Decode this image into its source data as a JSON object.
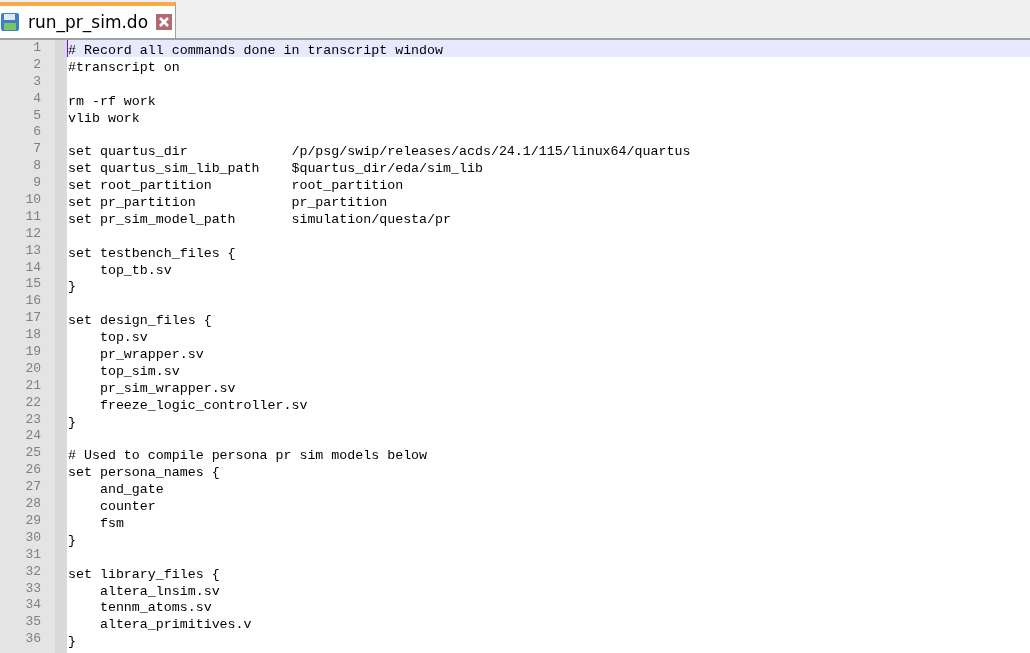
{
  "tabs": [
    {
      "label": "run_pr_sim.do",
      "selected": true
    }
  ],
  "lines": [
    {
      "number": "1",
      "text": "# Record all commands done in transcript window",
      "current": true
    },
    {
      "number": "2",
      "text": "#transcript on",
      "current": false
    },
    {
      "number": "3",
      "current": false
    },
    {
      "number": "4",
      "text": "rm -rf work",
      "current": false
    },
    {
      "number": "5",
      "text": "vlib work",
      "current": false
    },
    {
      "number": "6",
      "current": false
    },
    {
      "number": "7",
      "text": "set quartus_dir             /p/psg/swip/releases/acds/24.1/115/linux64/quartus",
      "current": false
    },
    {
      "number": "8",
      "text": "set quartus_sim_lib_path    $quartus_dir/eda/sim_lib",
      "current": false
    },
    {
      "number": "9",
      "text": "set root_partition          root_partition",
      "current": false
    },
    {
      "number": "10",
      "text": "set pr_partition            pr_partition",
      "current": false
    },
    {
      "number": "11",
      "text": "set pr_sim_model_path       simulation/questa/pr",
      "current": false
    },
    {
      "number": "12",
      "current": false
    },
    {
      "number": "13",
      "text": "set testbench_files {",
      "current": false
    },
    {
      "number": "14",
      "text": "    top_tb.sv",
      "current": false
    },
    {
      "number": "15",
      "text": "}",
      "current": false
    },
    {
      "number": "16",
      "current": false
    },
    {
      "number": "17",
      "text": "set design_files {",
      "current": false
    },
    {
      "number": "18",
      "text": "    top.sv",
      "current": false
    },
    {
      "number": "19",
      "text": "    pr_wrapper.sv",
      "current": false
    },
    {
      "number": "20",
      "text": "    top_sim.sv",
      "current": false
    },
    {
      "number": "21",
      "text": "    pr_sim_wrapper.sv",
      "current": false
    },
    {
      "number": "22",
      "text": "    freeze_logic_controller.sv",
      "current": false
    },
    {
      "number": "23",
      "text": "}",
      "current": false
    },
    {
      "number": "24",
      "current": false
    },
    {
      "number": "25",
      "text": "# Used to compile persona pr sim models below",
      "current": false
    },
    {
      "number": "26",
      "text": "set persona_names {",
      "current": false
    },
    {
      "number": "27",
      "text": "    and_gate",
      "current": false
    },
    {
      "number": "28",
      "text": "    counter",
      "current": false
    },
    {
      "number": "29",
      "text": "    fsm",
      "current": false
    },
    {
      "number": "30",
      "text": "}",
      "current": false
    },
    {
      "number": "31",
      "current": false
    },
    {
      "number": "32",
      "text": "set library_files {",
      "current": false
    },
    {
      "number": "33",
      "text": "    altera_lnsim.sv",
      "current": false
    },
    {
      "number": "34",
      "text": "    tennm_atoms.sv",
      "current": false
    },
    {
      "number": "35",
      "text": "    altera_primitives.v",
      "current": false
    },
    {
      "number": "36",
      "text": "}",
      "current": false
    }
  ]
}
